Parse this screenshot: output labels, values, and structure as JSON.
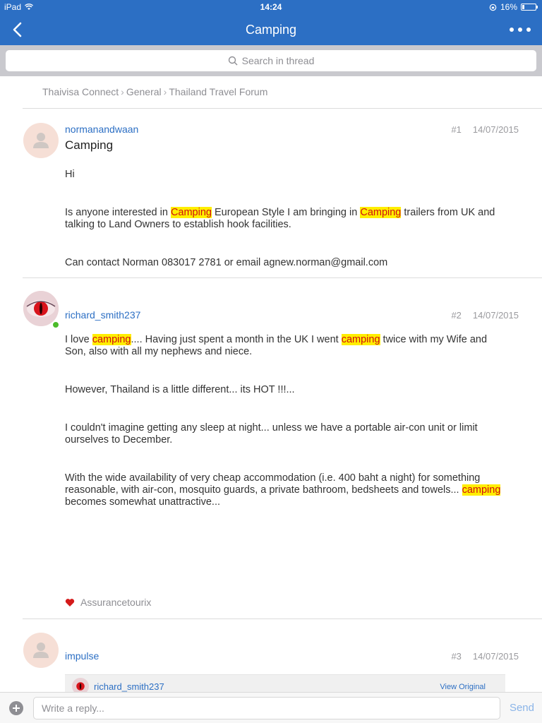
{
  "status_bar": {
    "device": "iPad",
    "time": "14:24",
    "battery": "16%"
  },
  "nav": {
    "title": "Camping"
  },
  "search": {
    "placeholder": "Search in thread"
  },
  "breadcrumb": [
    "Thaivisa Connect",
    "General",
    "Thailand Travel Forum"
  ],
  "posts": [
    {
      "author": "normanandwaan",
      "number": "#1",
      "date": "14/07/2015",
      "title": "Camping",
      "paragraphs": [
        [
          {
            "t": "Hi"
          }
        ],
        [
          {
            "t": "Is anyone interested in "
          },
          {
            "t": "Camping",
            "hl": true
          },
          {
            "t": " European Style I am bringing in "
          },
          {
            "t": "Camping",
            "hl": true
          },
          {
            "t": " trailers from UK and talking to Land Owners to establish hook facilities."
          }
        ],
        [
          {
            "t": "Can contact Norman 083017 2781 or email agnew.norman@gmail.com"
          }
        ]
      ]
    },
    {
      "author": "richard_smith237",
      "number": "#2",
      "date": "14/07/2015",
      "online": true,
      "paragraphs": [
        [
          {
            "t": "I love "
          },
          {
            "t": "camping",
            "hl": true
          },
          {
            "t": "....  Having just spent a month in the UK I went "
          },
          {
            "t": "camping",
            "hl": true
          },
          {
            "t": " twice with my Wife and Son, also with all my nephews and niece."
          }
        ],
        [
          {
            "t": "However, Thailand is a little different... its HOT !!!..."
          }
        ],
        [
          {
            "t": "I couldn't imagine getting any sleep at night... unless we have a portable air-con unit or limit ourselves to December."
          }
        ],
        [
          {
            "t": "With the wide availability of very cheap accommodation (i.e. 400 baht a night) for something reasonable, with air-con, mosquito guards, a private bathroom, bedsheets and towels... "
          },
          {
            "t": "camping",
            "hl": true
          },
          {
            "t": " becomes somewhat unattractive..."
          }
        ]
      ],
      "liked_by": "Assurancetourix"
    },
    {
      "author": "impulse",
      "number": "#3",
      "date": "14/07/2015",
      "quote": {
        "author": "richard_smith237",
        "view_label": "View Original"
      }
    }
  ],
  "reply": {
    "placeholder": "Write a reply...",
    "send_label": "Send"
  },
  "colors": {
    "accent": "#2c6fc4",
    "highlight_bg": "#ffee00",
    "highlight_text": "#d01010",
    "online": "#4cbb2a"
  },
  "icons": [
    "back-chevron-icon",
    "more-dots-icon",
    "search-icon",
    "wifi-icon",
    "battery-icon",
    "heart-icon",
    "add-icon",
    "default-avatar-icon"
  ]
}
